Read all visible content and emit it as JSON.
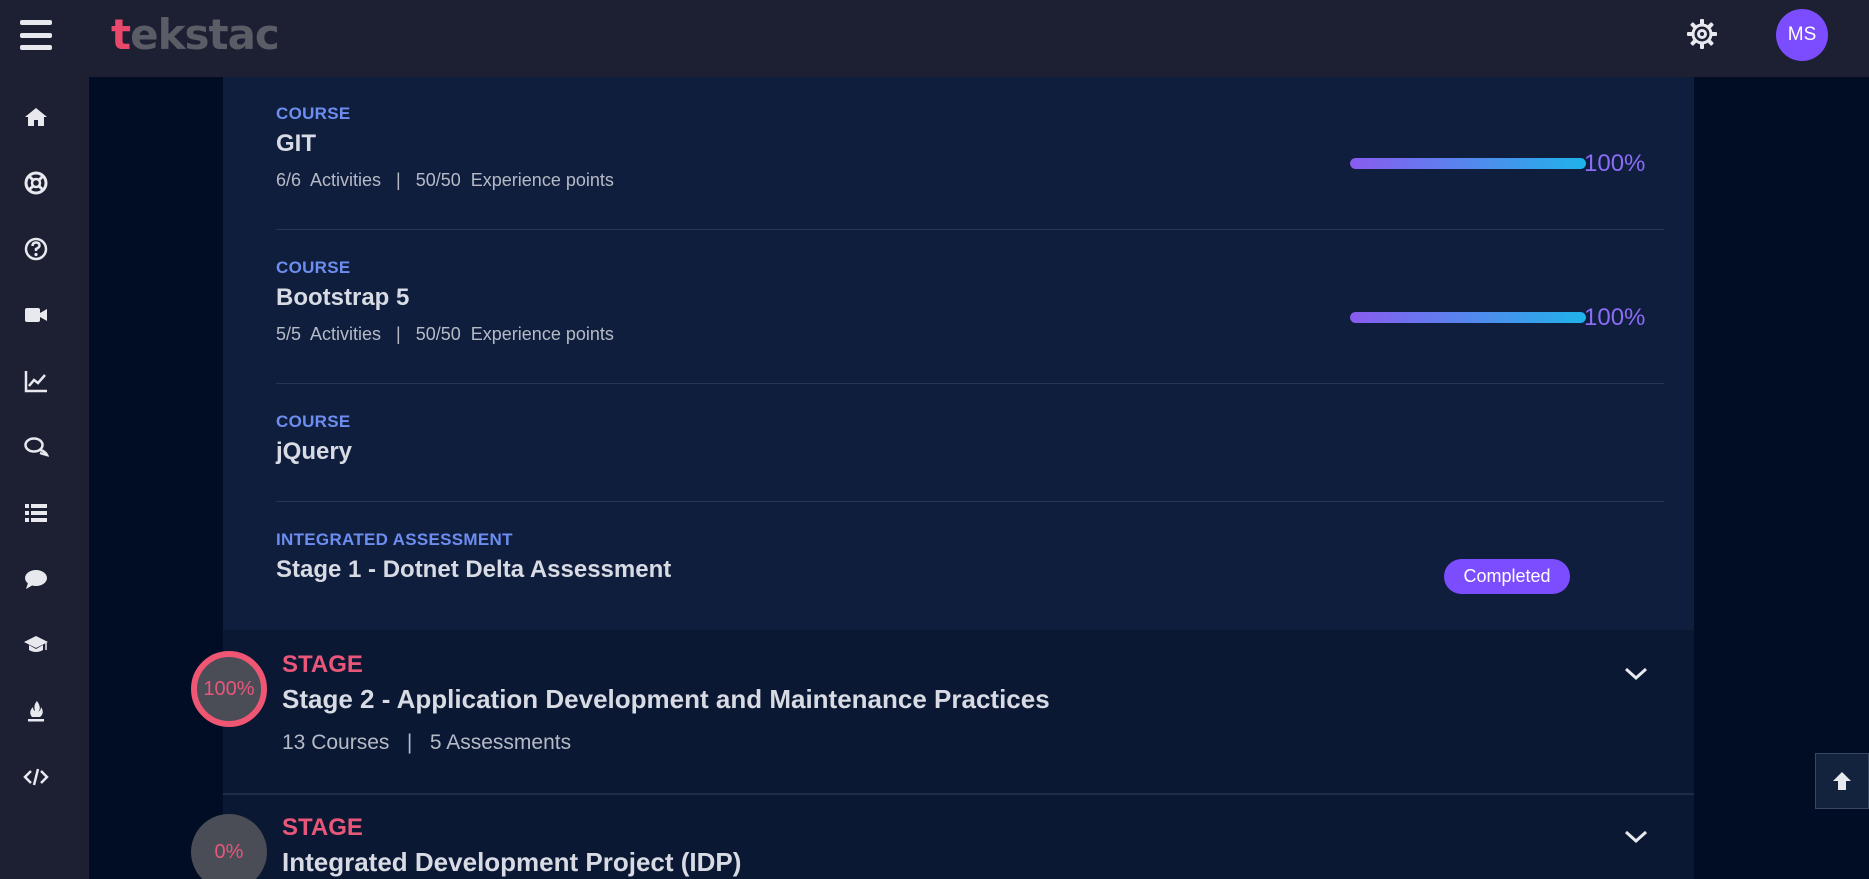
{
  "header": {
    "logo_text_first": "t",
    "logo_text_rest": "ekstac",
    "menu_icon": "hamburger-icon",
    "settings_icon": "gear-icon",
    "avatar_initials": "MS",
    "avatar_color": "#7c4dff"
  },
  "sidebar": {
    "items": [
      {
        "icon": "home-icon"
      },
      {
        "icon": "lifebuoy-icon"
      },
      {
        "icon": "help-icon"
      },
      {
        "icon": "video-icon"
      },
      {
        "icon": "chart-line-icon"
      },
      {
        "icon": "chat-bubbles-icon"
      },
      {
        "icon": "list-icon"
      },
      {
        "icon": "comment-icon"
      },
      {
        "icon": "graduation-cap-icon"
      },
      {
        "icon": "fire-icon"
      },
      {
        "icon": "code-icon"
      }
    ]
  },
  "courses": [
    {
      "kind": "COURSE",
      "title": "GIT",
      "meta": "6/6  Activities   |   50/50  Experience points",
      "progress": 1.0,
      "percent": "100%"
    },
    {
      "kind": "COURSE",
      "title": "Bootstrap 5",
      "meta": "5/5  Activities   |   50/50  Experience points",
      "progress": 1.0,
      "percent": "100%"
    },
    {
      "kind": "COURSE",
      "title": "jQuery"
    },
    {
      "kind": "INTEGRATED ASSESSMENT",
      "title": "Stage 1 - Dotnet Delta Assessment",
      "status": "Completed"
    }
  ],
  "stages": [
    {
      "kind": "STAGE",
      "percent": "100%",
      "title": "Stage 2 - Application Development and Maintenance Practices",
      "meta": "13 Courses   |   5 Assessments"
    },
    {
      "kind": "STAGE",
      "percent": "0%",
      "title": "Integrated Development Project (IDP)"
    }
  ],
  "colors": {
    "accent_purple": "#7c4dff",
    "course_kind_blue": "#6d8ef0",
    "stage_pink": "#e8577a"
  }
}
